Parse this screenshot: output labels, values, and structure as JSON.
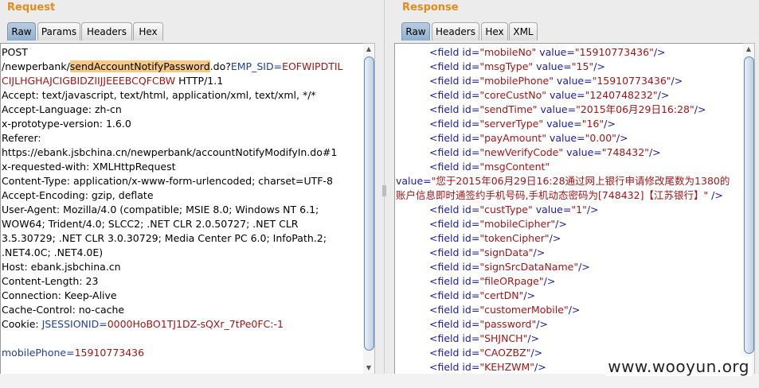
{
  "request": {
    "title": "Request",
    "tabs": [
      "Raw",
      "Params",
      "Headers",
      "Hex"
    ],
    "active_tab": "Raw",
    "lines": {
      "method": "POST",
      "path_prefix": "/newperbank/",
      "path_highlight": "sendAccountNotifyPassword",
      "path_suffix": ".do?",
      "param_name": "EMP_SID",
      "eq": "=",
      "param_value_1": "EOFWIPDTIL",
      "param_value_2": "CIJLHGHAJCIGBIDZIIJJEEEBCQFCBW",
      "http_version": " HTTP/1.1",
      "accept": "Accept: text/javascript, text/html, application/xml, text/xml, */*",
      "accept_language": "Accept-Language: zh-cn",
      "x_prototype": "x-prototype-version: 1.6.0",
      "referer_label": "Referer:",
      "referer_value": "https://ebank.jsbchina.cn/newperbank/accountNotifyModifyIn.do#1",
      "x_requested": "x-requested-with: XMLHttpRequest",
      "content_type": "Content-Type: application/x-www-form-urlencoded; charset=UTF-8",
      "accept_encoding": "Accept-Encoding: gzip, deflate",
      "ua_1": "User-Agent: Mozilla/4.0 (compatible; MSIE 8.0; Windows NT 6.1;",
      "ua_2": "WOW64; Trident/4.0; SLCC2; .NET CLR 2.0.50727; .NET CLR",
      "ua_3": "3.5.30729; .NET CLR 3.0.30729; Media Center PC 6.0; InfoPath.2;",
      "ua_4": ".NET4.0C; .NET4.0E)",
      "host": "Host: ebank.jsbchina.cn",
      "content_length": "Content-Length: 23",
      "connection": "Connection: Keep-Alive",
      "cache_control": "Cache-Control: no-cache",
      "cookie_label": "Cookie: ",
      "cookie_name": "JSESSIONID",
      "cookie_value": "0000HoBO1TJ1DZ-sQXr_7tPe0FC:-1",
      "body_name": "mobilePhone",
      "body_value": "15910773436"
    }
  },
  "response": {
    "title": "Response",
    "tabs": [
      "Raw",
      "Headers",
      "Hex",
      "XML"
    ],
    "active_tab": "Raw",
    "fields": [
      {
        "id": "mobileNo",
        "value": "15910773436"
      },
      {
        "id": "msgType",
        "value": "15"
      },
      {
        "id": "mobilePhone",
        "value": "15910773436"
      },
      {
        "id": "coreCustNo",
        "value": "1240748232"
      },
      {
        "id": "sendTime",
        "value": "2015年06月29日16:28"
      },
      {
        "id": "serverType",
        "value": "16"
      },
      {
        "id": "payAmount",
        "value": "0.00"
      },
      {
        "id": "newVerifyCode",
        "value": "748432"
      },
      {
        "id": "msgContent"
      }
    ],
    "msg_value_1": "您于2015年06月29日16:28通过网上银行申请修改尾数为1380的",
    "msg_value_2": "账户信息即时通签约手机号码,手机动态密码为[748432]【江苏银行】",
    "fields_after": [
      {
        "id": "custType",
        "value": "1"
      },
      {
        "id": "mobileCipher"
      },
      {
        "id": "tokenCipher"
      },
      {
        "id": "signData"
      },
      {
        "id": "signSrcDataName"
      },
      {
        "id": "fileORpage"
      },
      {
        "id": "certDN"
      },
      {
        "id": "customerMobile"
      },
      {
        "id": "password"
      },
      {
        "id": "SHJNCH"
      },
      {
        "id": "CAOZBZ"
      },
      {
        "id": "KEHZWM"
      }
    ]
  },
  "watermark": "www.wooyun.org"
}
